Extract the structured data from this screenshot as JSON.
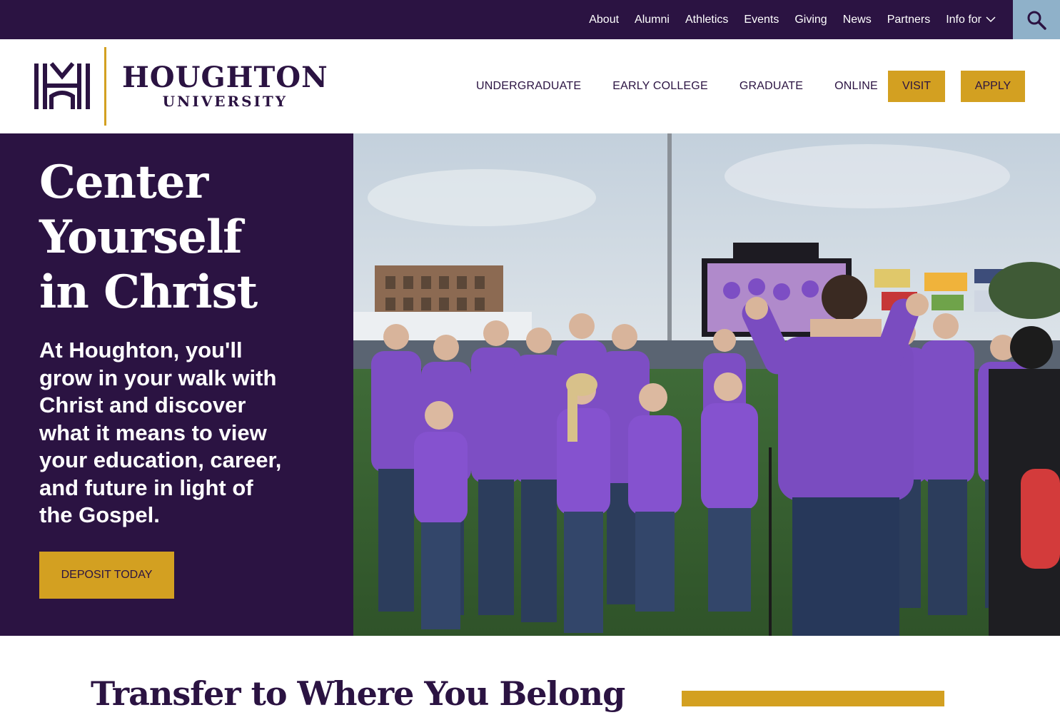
{
  "utility_nav": {
    "items": [
      "About",
      "Alumni",
      "Athletics",
      "Events",
      "Giving",
      "News",
      "Partners"
    ],
    "info_for": "Info for"
  },
  "logo": {
    "wordmark_top": "Houghton",
    "wordmark_bottom": "University"
  },
  "primary_nav": {
    "items": [
      "UNDERGRADUATE",
      "EARLY COLLEGE",
      "GRADUATE",
      "ONLINE"
    ],
    "visit": "VISIT",
    "apply": "APPLY"
  },
  "hero": {
    "title": "Center Yourself in Christ",
    "subtitle": "At Houghton, you'll grow in your walk with Christ and discover what it means to view your education, career, and future in light of the Gospel.",
    "cta": "DEPOSIT TODAY"
  },
  "section": {
    "title": "Transfer to Where You Belong"
  },
  "colors": {
    "brand_purple": "#2b1342",
    "accent_gold": "#d3a021",
    "search_blue": "#8fb1c9",
    "shirt_purple": "#7d4ec4"
  }
}
